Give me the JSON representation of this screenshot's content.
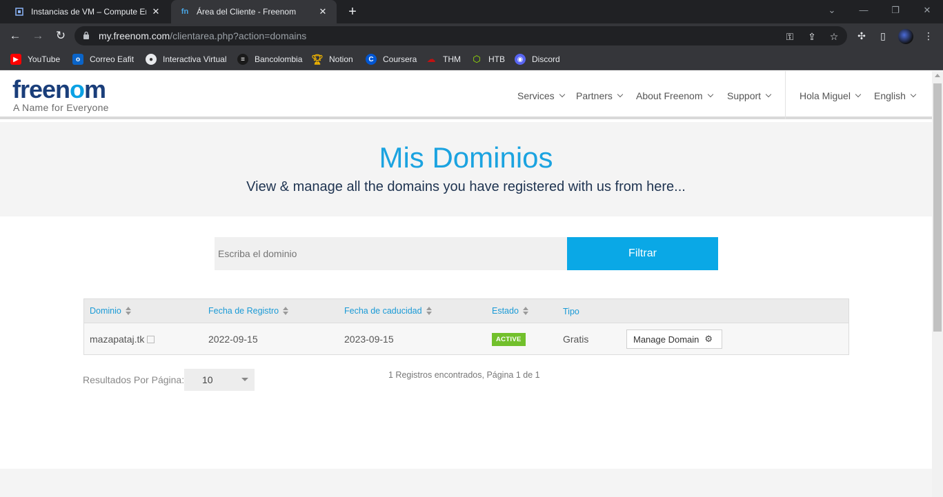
{
  "browser": {
    "tabs": [
      {
        "title": "Instancias de VM – Compute Engine",
        "icon": "compute-engine-icon"
      },
      {
        "title": "Área del Cliente - Freenom",
        "icon": "freenom-icon"
      }
    ],
    "url_host": "my.freenom.com",
    "url_path": "/clientarea.php?action=domains",
    "bookmarks": [
      "YouTube",
      "Correo Eafit",
      "Interactiva Virtual",
      "Bancolombia",
      "Notion",
      "Coursera",
      "THM",
      "HTB",
      "Discord"
    ]
  },
  "site": {
    "logo_free": "free",
    "logo_n": "n",
    "logo_o": "o",
    "logo_m": "m",
    "tagline": "A Name for Everyone",
    "nav": [
      "Services",
      "Partners",
      "About Freenom",
      "Support"
    ],
    "user_menu": "Hola Miguel",
    "language": "English"
  },
  "hero": {
    "title": "Mis Dominios",
    "subtitle": "View & manage all the domains you have registered with us from here..."
  },
  "filter": {
    "placeholder": "Escriba el dominio",
    "button": "Filtrar"
  },
  "table": {
    "headers": [
      "Dominio",
      "Fecha de Registro",
      "Fecha de caducidad",
      "Estado",
      "Tipo"
    ],
    "rows": [
      {
        "domain": "mazapataj.tk",
        "registered": "2022-09-15",
        "expires": "2023-09-15",
        "status": "ACTIVE",
        "type": "Gratis",
        "action": "Manage Domain"
      }
    ]
  },
  "pagination": {
    "per_page_label": "Resultados Por Página:",
    "per_page_value": "10",
    "summary": "1 Registros encontrados, Página 1 de 1"
  },
  "colors": {
    "accent": "#0aa8e6",
    "brand_dark": "#1a3e7a",
    "status_active": "#72c02c"
  }
}
